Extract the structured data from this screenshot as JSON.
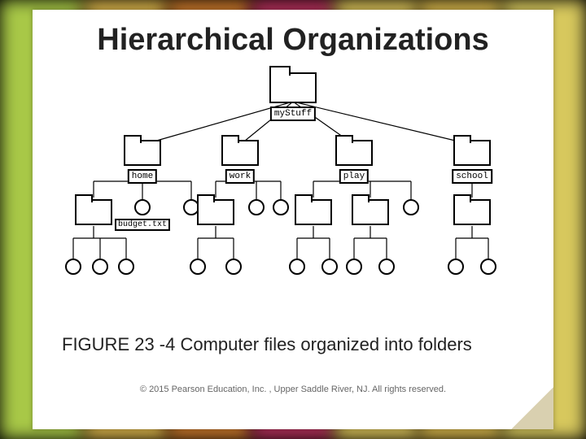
{
  "title": "Hierarchical Organizations",
  "caption": "FIGURE 23 -4 Computer files organized into folders",
  "copyright": "© 2015 Pearson Education, Inc. , Upper Saddle River, NJ.  All rights reserved.",
  "tree": {
    "root": {
      "label": "myStuff",
      "type": "folder"
    },
    "level2": [
      {
        "label": "home",
        "type": "folder"
      },
      {
        "label": "work",
        "type": "folder"
      },
      {
        "label": "play",
        "type": "folder"
      },
      {
        "label": "school",
        "type": "folder"
      }
    ],
    "home_children": [
      {
        "type": "folder"
      },
      {
        "type": "file",
        "label": "budget.txt"
      },
      {
        "type": "file"
      }
    ],
    "work_children": [
      {
        "type": "folder"
      },
      {
        "type": "file"
      },
      {
        "type": "file"
      }
    ],
    "play_children": [
      {
        "type": "folder"
      },
      {
        "type": "folder"
      },
      {
        "type": "file"
      }
    ],
    "school_children": [
      {
        "type": "folder"
      }
    ],
    "home_grandchildren": [
      {
        "type": "file"
      },
      {
        "type": "file"
      },
      {
        "type": "file"
      }
    ],
    "work_grandchildren": [
      {
        "type": "file"
      },
      {
        "type": "file"
      }
    ],
    "play_grandchildren_a": [
      {
        "type": "file"
      },
      {
        "type": "file"
      }
    ],
    "play_grandchildren_b": [
      {
        "type": "file"
      },
      {
        "type": "file"
      }
    ],
    "school_grandchildren": [
      {
        "type": "file"
      },
      {
        "type": "file"
      }
    ]
  }
}
